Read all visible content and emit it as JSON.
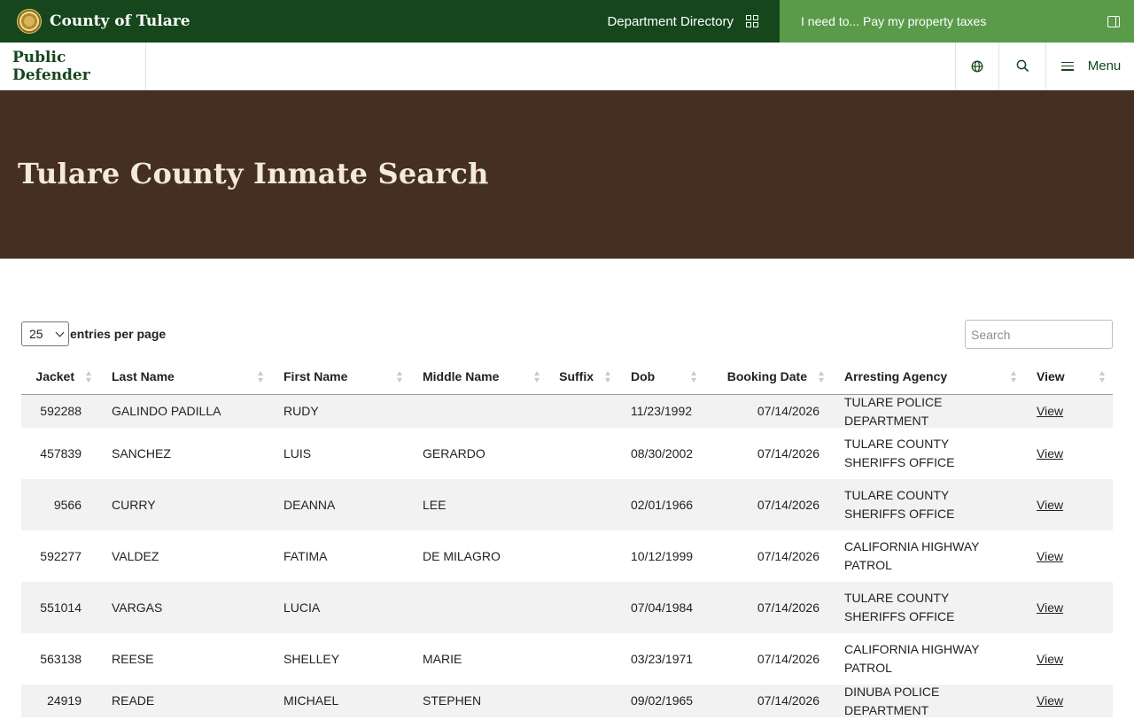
{
  "topbar": {
    "site_name": "County of Tulare",
    "department_directory": "Department Directory",
    "i_need_to": "I need to... Pay my property taxes"
  },
  "deptbar": {
    "department_name": "Public Defender",
    "menu_label": "Menu"
  },
  "hero": {
    "title": "Tulare County Inmate Search"
  },
  "controls": {
    "per_page_value": "25",
    "per_page_label": "entries per page",
    "search_placeholder": "Search"
  },
  "table": {
    "columns": [
      "Jacket",
      "Last Name",
      "First Name",
      "Middle Name",
      "Suffix",
      "Dob",
      "Booking Date",
      "Arresting Agency",
      "View"
    ],
    "rows": [
      {
        "jacket": "592288",
        "last": "GALINDO PADILLA",
        "first": "RUDY",
        "middle": "",
        "suffix": "",
        "dob": "11/23/1992",
        "booking": "07/14/2026",
        "agency": "TULARE POLICE DEPARTMENT",
        "view": "View"
      },
      {
        "jacket": "457839",
        "last": "SANCHEZ",
        "first": "LUIS",
        "middle": "GERARDO",
        "suffix": "",
        "dob": "08/30/2002",
        "booking": "07/14/2026",
        "agency": "TULARE COUNTY SHERIFFS OFFICE",
        "view": "View"
      },
      {
        "jacket": "9566",
        "last": "CURRY",
        "first": "DEANNA",
        "middle": "LEE",
        "suffix": "",
        "dob": "02/01/1966",
        "booking": "07/14/2026",
        "agency": "TULARE COUNTY SHERIFFS OFFICE",
        "view": "View"
      },
      {
        "jacket": "592277",
        "last": "VALDEZ",
        "first": "FATIMA",
        "middle": "DE MILAGRO",
        "suffix": "",
        "dob": "10/12/1999",
        "booking": "07/14/2026",
        "agency": "CALIFORNIA HIGHWAY PATROL",
        "view": "View"
      },
      {
        "jacket": "551014",
        "last": "VARGAS",
        "first": "LUCIA",
        "middle": "",
        "suffix": "",
        "dob": "07/04/1984",
        "booking": "07/14/2026",
        "agency": "TULARE COUNTY SHERIFFS OFFICE",
        "view": "View"
      },
      {
        "jacket": "563138",
        "last": "REESE",
        "first": "SHELLEY",
        "middle": "MARIE",
        "suffix": "",
        "dob": "03/23/1971",
        "booking": "07/14/2026",
        "agency": "CALIFORNIA HIGHWAY PATROL",
        "view": "View"
      },
      {
        "jacket": "24919",
        "last": "READE",
        "first": "MICHAEL",
        "middle": "STEPHEN",
        "suffix": "",
        "dob": "09/02/1965",
        "booking": "07/14/2026",
        "agency": "DINUBA POLICE DEPARTMENT",
        "view": "View"
      }
    ]
  },
  "colors": {
    "topbar_bg": "#16461c",
    "ineed_bg": "#5a9b4a",
    "hero_bg": "#452f22",
    "hero_title": "#f3ead7"
  },
  "icons": [
    "county-seal-icon",
    "directory-grid-icon",
    "side-panel-icon",
    "globe-icon",
    "search-icon",
    "menu-icon",
    "sort-icon",
    "chevron-down-icon"
  ]
}
